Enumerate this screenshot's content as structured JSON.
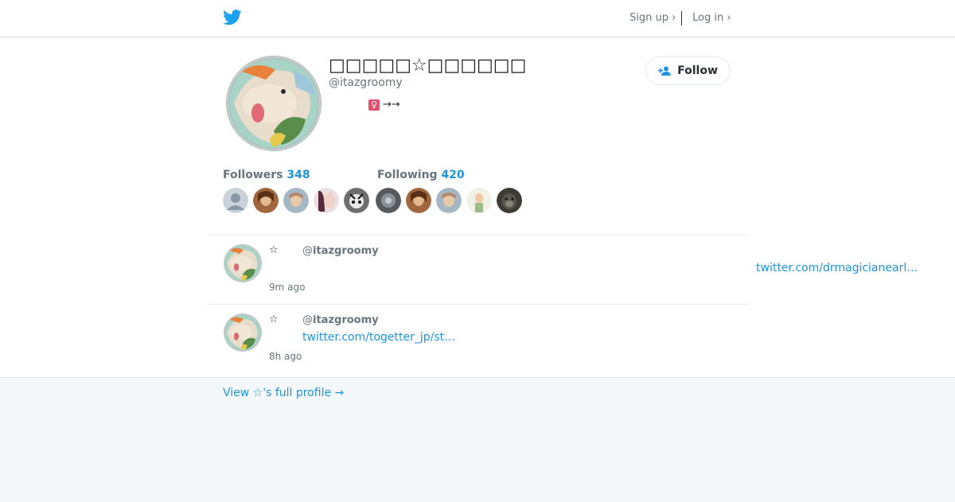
{
  "topbar": {
    "logo_icon": "twitter-bird-icon",
    "brand_color": "#1da1f2",
    "signup_label": "Sign up ›",
    "login_label": "Log in ›"
  },
  "profile": {
    "display_name": "□□□□□☆□□□□□□",
    "handle": "@itazgroomy",
    "bio_symbol": "♀",
    "bio_arrows": "→→",
    "follow_label": "Follow",
    "follow_icon": "add-person-icon"
  },
  "stats": {
    "followers_label": "Followers",
    "followers_count": "348",
    "following_label": "Following",
    "following_count": "420"
  },
  "tweets": [
    {
      "star": "☆",
      "handle_prefix": "@",
      "handle": "itazgroomy",
      "link": "twitter.com/drmagicianearl…",
      "time": "9m ago"
    },
    {
      "star": "☆",
      "handle_prefix": "@",
      "handle": "itazgroomy",
      "link": "twitter.com/togetter_jp/st…",
      "time": "8h ago"
    }
  ],
  "footer": {
    "full_profile_label": "View ☆'s full profile →"
  },
  "colors": {
    "link": "#1b95e0",
    "muted": "#66757f",
    "footer_bg": "#f5f8fa"
  }
}
